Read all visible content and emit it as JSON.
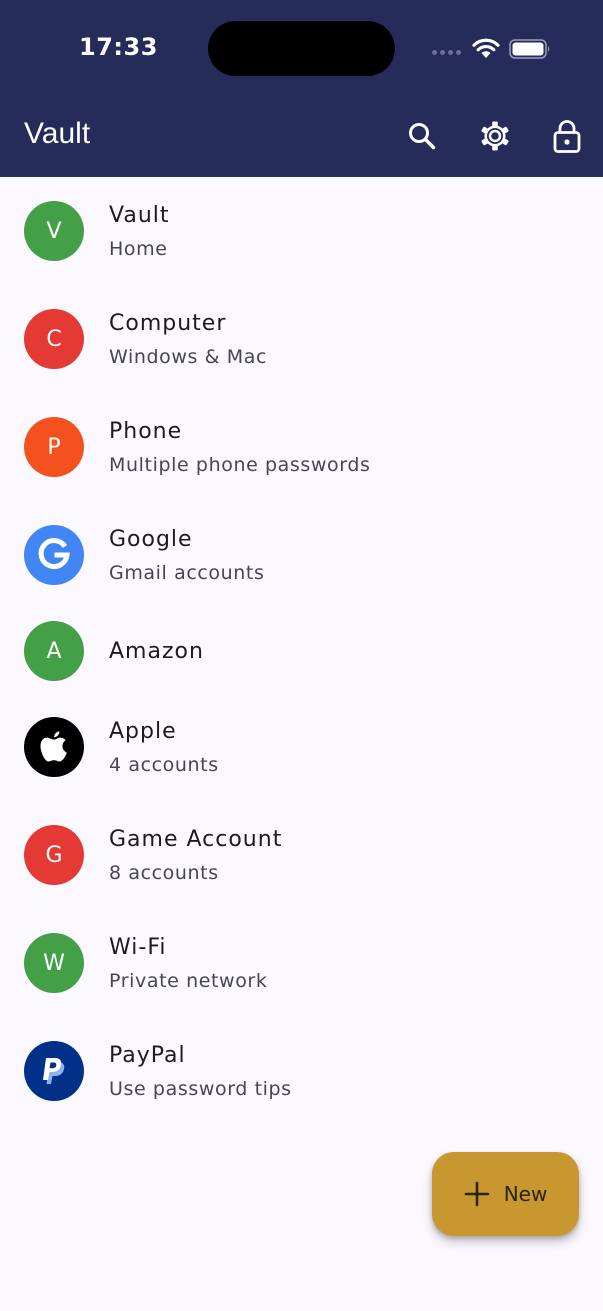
{
  "status_bar": {
    "time": "17:33"
  },
  "app_bar": {
    "title": "Vault",
    "actions": [
      {
        "icon": "search-icon"
      },
      {
        "icon": "gear-icon"
      },
      {
        "icon": "lock-icon"
      }
    ]
  },
  "items": [
    {
      "title": "Vault",
      "subtitle": "Home",
      "avatar_letter": "V",
      "avatar_color": "#43A047"
    },
    {
      "title": "Computer",
      "subtitle": "Windows & Mac",
      "avatar_letter": "C",
      "avatar_color": "#E53935"
    },
    {
      "title": "Phone",
      "subtitle": "Multiple phone passwords",
      "avatar_letter": "P",
      "avatar_color": "#F4511E"
    },
    {
      "title": "Google",
      "subtitle": "Gmail accounts",
      "avatar_letter": "",
      "avatar_color": "#4285F4",
      "avatar_icon": "google-logo-icon"
    },
    {
      "title": "Amazon",
      "subtitle": "",
      "avatar_letter": "A",
      "avatar_color": "#43A047"
    },
    {
      "title": "Apple",
      "subtitle": "4 accounts",
      "avatar_letter": "",
      "avatar_color": "#000000",
      "avatar_icon": "apple-logo-icon"
    },
    {
      "title": "Game Account",
      "subtitle": "8 accounts",
      "avatar_letter": "G",
      "avatar_color": "#E53935"
    },
    {
      "title": "Wi-Fi",
      "subtitle": "Private network",
      "avatar_letter": "W",
      "avatar_color": "#43A047"
    },
    {
      "title": "PayPal",
      "subtitle": "Use password tips",
      "avatar_letter": "",
      "avatar_color": "#003087",
      "avatar_icon": "paypal-logo-icon"
    }
  ],
  "fab": {
    "label": "New",
    "icon": "plus-icon",
    "color": "#C8972F"
  },
  "colors": {
    "app_bar": "#252C5A",
    "background": "#FCF8FF"
  }
}
